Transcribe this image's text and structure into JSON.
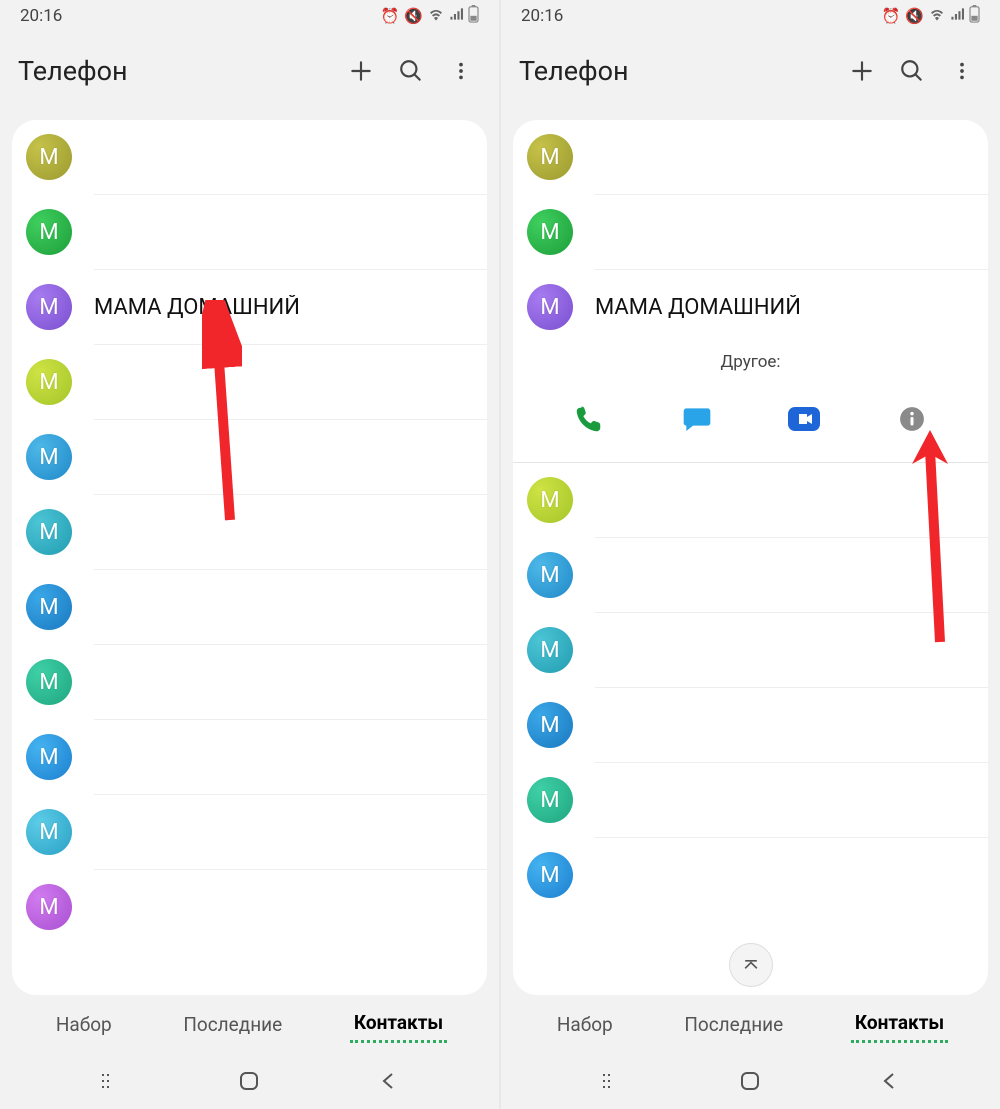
{
  "status": {
    "time": "20:16"
  },
  "app": {
    "title": "Телефон"
  },
  "contacts_left": [
    {
      "letter": "M",
      "name": "",
      "bg": "radial-gradient(circle at 30% 30%, #c6c24a, #9a9a2e)"
    },
    {
      "letter": "M",
      "name": "",
      "bg": "radial-gradient(circle at 30% 30%, #3fcf5e, #1d9e3a)"
    },
    {
      "letter": "M",
      "name": "МАМА ДОМАШНИЙ",
      "bg": "radial-gradient(circle at 30% 30%, #a77bf0, #7a4fd0)"
    },
    {
      "letter": "M",
      "name": "",
      "bg": "radial-gradient(circle at 30% 30%, #cfe344, #a4c52a)"
    },
    {
      "letter": "M",
      "name": "",
      "bg": "radial-gradient(circle at 30% 30%, #4db8e8, #2089c9)"
    },
    {
      "letter": "M",
      "name": "",
      "bg": "radial-gradient(circle at 30% 30%, #4cc5d6, #219cb0)"
    },
    {
      "letter": "M",
      "name": "",
      "bg": "radial-gradient(circle at 30% 30%, #3aa8e8, #1a78c0)"
    },
    {
      "letter": "M",
      "name": "",
      "bg": "radial-gradient(circle at 30% 30%, #3fd0a6, #1fa680)"
    },
    {
      "letter": "M",
      "name": "",
      "bg": "radial-gradient(circle at 30% 30%, #44b3f0, #1c7fd0)"
    },
    {
      "letter": "M",
      "name": "",
      "bg": "radial-gradient(circle at 30% 30%, #5ccde8, #2aa0c4)"
    },
    {
      "letter": "M",
      "name": "",
      "bg": "radial-gradient(circle at 30% 30%, #d17bf0, #a84fd0)"
    }
  ],
  "contacts_right": [
    {
      "letter": "M",
      "name": "",
      "bg": "radial-gradient(circle at 30% 30%, #c6c24a, #9a9a2e)"
    },
    {
      "letter": "M",
      "name": "",
      "bg": "radial-gradient(circle at 30% 30%, #3fcf5e, #1d9e3a)"
    },
    {
      "letter": "M",
      "name": "МАМА ДОМАШНИЙ",
      "bg": "radial-gradient(circle at 30% 30%, #a77bf0, #7a4fd0)",
      "expanded": true
    },
    {
      "letter": "M",
      "name": "",
      "bg": "radial-gradient(circle at 30% 30%, #cfe344, #a4c52a)"
    },
    {
      "letter": "M",
      "name": "",
      "bg": "radial-gradient(circle at 30% 30%, #4db8e8, #2089c9)"
    },
    {
      "letter": "M",
      "name": "",
      "bg": "radial-gradient(circle at 30% 30%, #4cc5d6, #219cb0)"
    },
    {
      "letter": "M",
      "name": "",
      "bg": "radial-gradient(circle at 30% 30%, #3aa8e8, #1a78c0)"
    },
    {
      "letter": "M",
      "name": "",
      "bg": "radial-gradient(circle at 30% 30%, #3fd0a6, #1fa680)"
    },
    {
      "letter": "M",
      "name": "",
      "bg": "radial-gradient(circle at 30% 30%, #44b3f0, #1c7fd0)"
    }
  ],
  "expanded": {
    "label": "Другое:"
  },
  "tabs": {
    "t1": "Набор",
    "t2": "Последние",
    "t3": "Контакты"
  },
  "colors": {
    "call": "#1a9c3e",
    "msg": "#2aa4e8",
    "duo": "#1e66d8",
    "info": "#8a8a8a"
  }
}
